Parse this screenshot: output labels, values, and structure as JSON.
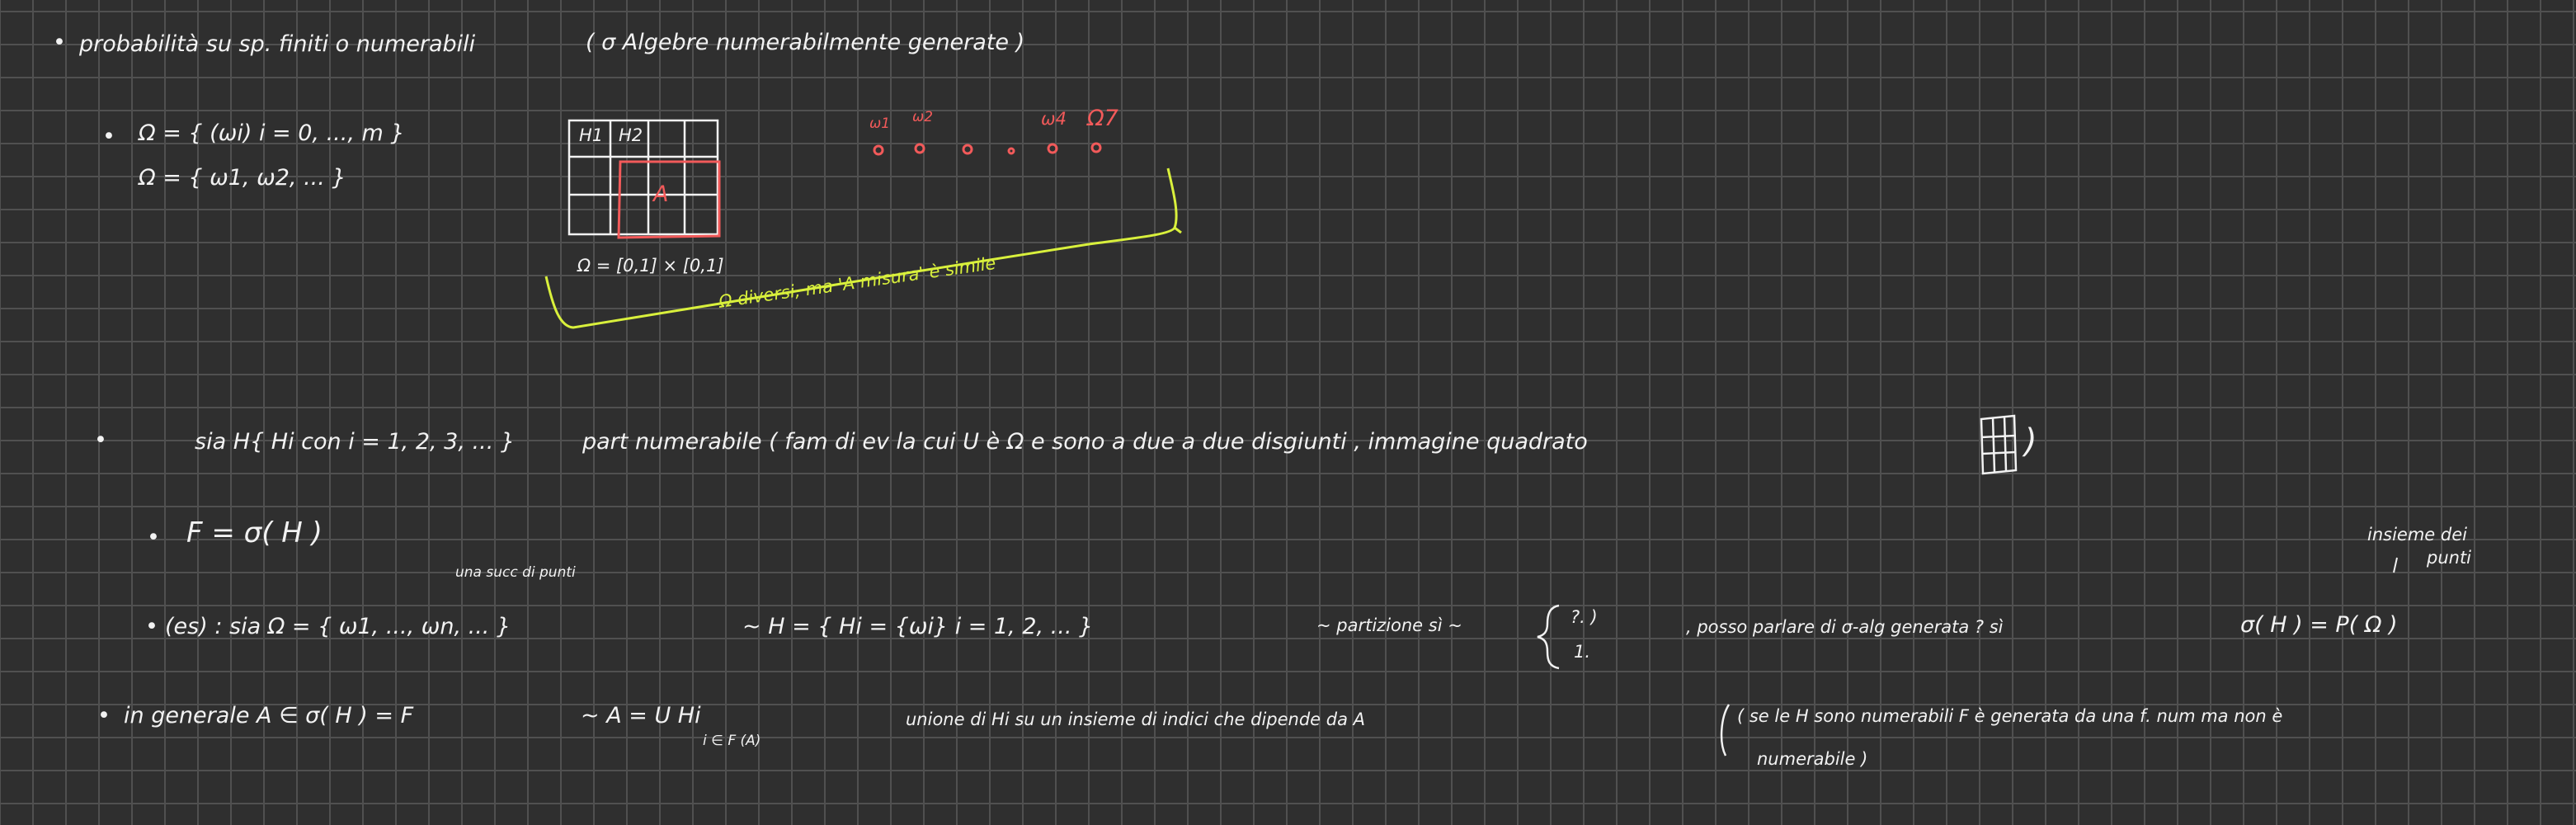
{
  "colors": {
    "background": "#2f2f2f",
    "grid": "#505050",
    "ink": "#f2f2f2",
    "red": "#f25a5a",
    "lime": "#d9f03c"
  },
  "line1": {
    "bullet": "•",
    "text": "probabilità  su  sp. finiti  o numerabili",
    "paren": "(  σ Algebre numerabilmente generate  )"
  },
  "omega_examples": {
    "bullet": "•",
    "line_a": "Ω = { (ωi)     i = 0, ..., m }",
    "line_b": "Ω = { ω1, ω2, ... }"
  },
  "grid_figure": {
    "cell_h1": "H1",
    "cell_h2": "H2",
    "set_label": "A",
    "omega_def": "Ω = [0,1] × [0,1]"
  },
  "red_points": {
    "w1": "ω1",
    "w2": "ω2",
    "w4": "ω4",
    "w7": "Ω7"
  },
  "lime_note": "Ω diversi, ma 'A misura' è simile",
  "partition_line": {
    "bullet": "•",
    "part1": "sia  H{ Hi   con  i = 1, 2, 3, ...  }",
    "part2": "part numerabile ( fam di ev   la cui  U  è  Ω    e sono a due a due    disgiunti ,  immagine quadrato",
    "close": ")"
  },
  "f_line": {
    "bullet": "•",
    "text": "F = σ( H )"
  },
  "note_right": {
    "line1": "insieme dei",
    "line2": "punti"
  },
  "succ_note": "una succ di punti",
  "ex_line": {
    "bullet": "•",
    "part1": "(es)  :  sia   Ω = { ω1, ..., ωn, ... }",
    "part2": "~  H = {  Hi = {ωi}   i = 1, 2, ... }",
    "part3": "~ partizione  sì ~",
    "brace_top": "?. )",
    "brace_bot": "1.",
    "part4": ", posso parlare di  σ-alg generata ?   sì",
    "part5": "σ( H ) = P( Ω )"
  },
  "general_line": {
    "bullet": "•",
    "part1": "in generale     A ∈ σ( H ) = F",
    "part2": "~  A =  U    Hi",
    "sub": "i ∈ F (A)",
    "part3": "unione di Hi    su  un insieme di indici  che dipende da A",
    "part4": "( se le  H  sono numerabili    F  è  generata da   una f. num  ma non è",
    "part5": "numerabile )"
  }
}
